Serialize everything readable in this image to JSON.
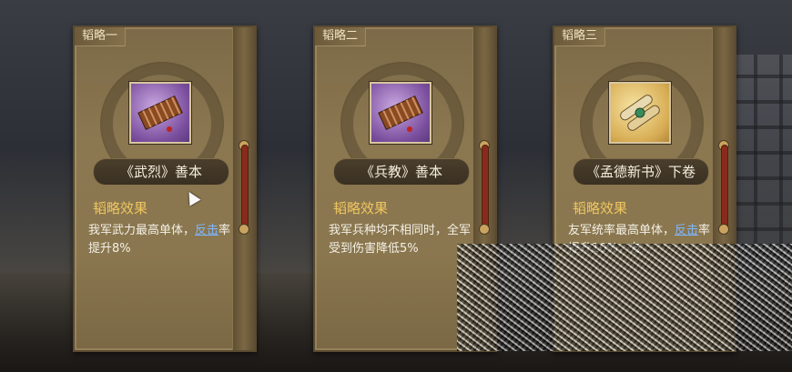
{
  "cards": [
    {
      "tag": "韬略一",
      "icon": "bamboo-scroll-icon",
      "icon_bg": "purple",
      "name": "《武烈》善本",
      "effect_title": "韬略效果",
      "desc_pre": "我军武力最高单体，",
      "desc_link": "反击",
      "desc_post": "率提升8%"
    },
    {
      "tag": "韬略二",
      "icon": "bamboo-scroll-icon",
      "icon_bg": "purple",
      "name": "《兵教》善本",
      "effect_title": "韬略效果",
      "desc_pre": "我军兵种均不相同时，全军受到伤害降低5%",
      "desc_link": "",
      "desc_post": ""
    },
    {
      "tag": "韬略三",
      "icon": "paper-scroll-icon",
      "icon_bg": "gold",
      "name": "《孟德新书》下卷",
      "effect_title": "韬略效果",
      "desc_pre": "友军统率最高单体，",
      "desc_link": "反击",
      "desc_post": "率提升10%，友"
    }
  ],
  "colors": {
    "effect_title": "#f0c660",
    "highlight": "#7fb7ff",
    "card_bg": "#8b7750"
  }
}
